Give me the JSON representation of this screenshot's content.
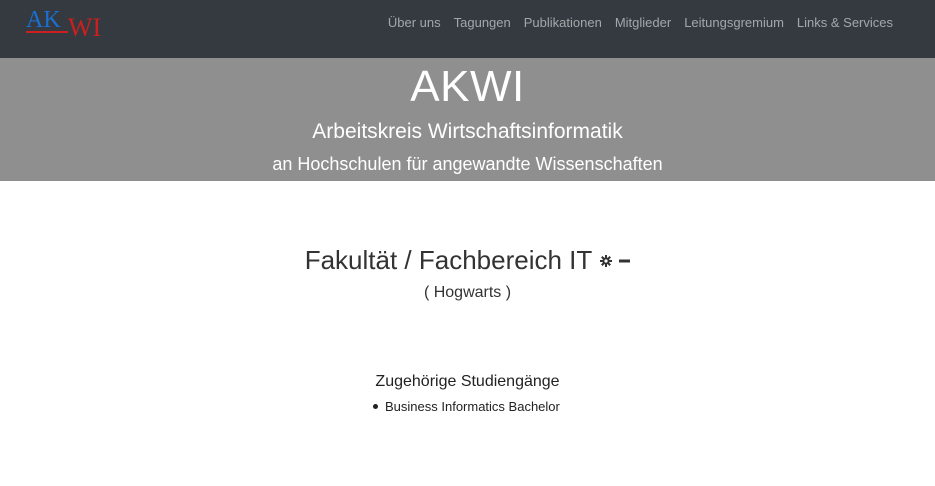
{
  "nav": {
    "logo": {
      "text_ak": "AK",
      "text_wi": "WI"
    },
    "links": [
      "Über uns",
      "Tagungen",
      "Publikationen",
      "Mitglieder",
      "Leitungsgremium",
      "Links & Services"
    ]
  },
  "hero": {
    "title": "AKWI",
    "subtitle": "Arbeitskreis Wirtschaftsinformatik",
    "subtitle2": "an Hochschulen für angewandte Wissenschaften"
  },
  "faculty": {
    "title": "Fakultät / Fachbereich IT",
    "institution": "( Hogwarts )",
    "settings_icon": "gear-icon",
    "remove_icon": "minus-icon"
  },
  "programs": {
    "heading": "Zugehörige Studiengänge",
    "items": [
      "Business Informatics Bachelor"
    ]
  },
  "colors": {
    "navbar": "#343a40",
    "hero": "#8f8f8f",
    "logo_blue": "#1a6fd0",
    "logo_red": "#cc1f1f"
  }
}
